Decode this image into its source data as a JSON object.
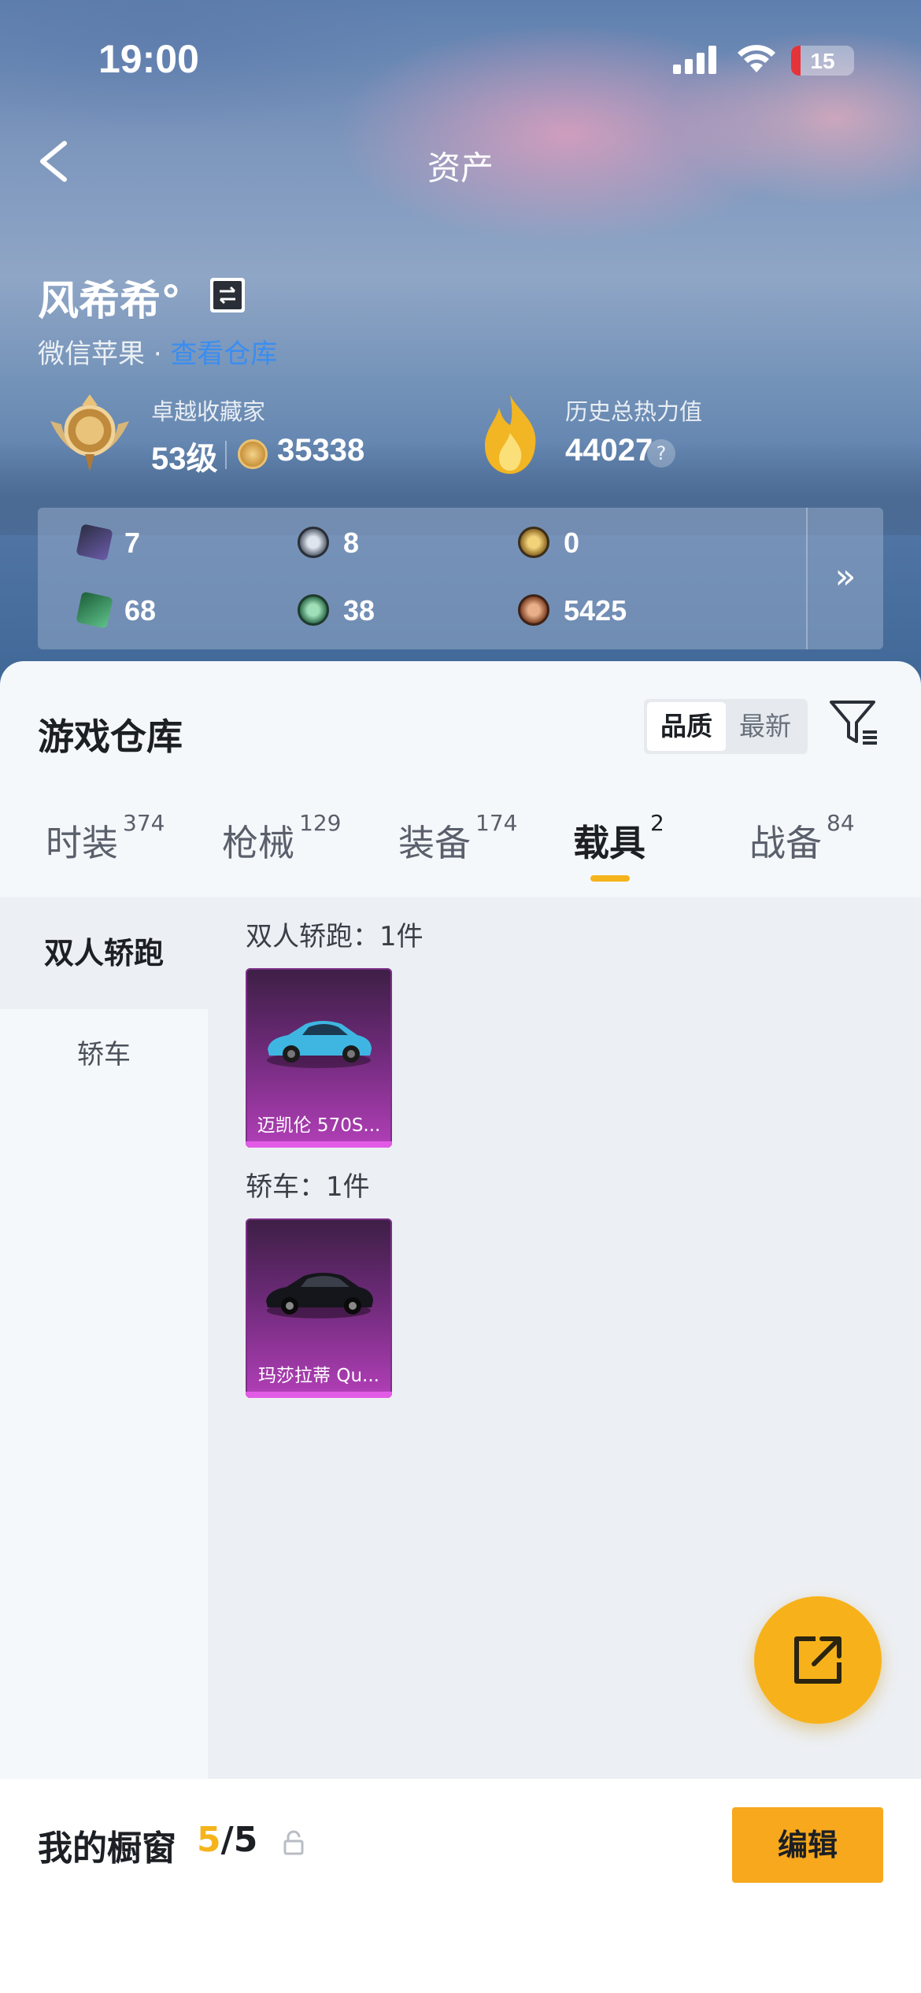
{
  "status": {
    "time": "19:00",
    "battery": "15"
  },
  "nav": {
    "title": "资产"
  },
  "profile": {
    "name": "风希希°",
    "platform": "微信苹果",
    "platform_link": "查看仓库",
    "collector": {
      "label": "卓越收藏家",
      "level": "53级",
      "points": "35338"
    },
    "heat": {
      "label": "历史总热力值",
      "value": "44027"
    }
  },
  "stats": [
    {
      "icon": "purple-card-icon",
      "value": "7"
    },
    {
      "icon": "gray-coin-icon",
      "value": "8"
    },
    {
      "icon": "gold-coin-icon",
      "value": "0"
    },
    {
      "icon": "green-card-icon",
      "value": "68"
    },
    {
      "icon": "green-coin-icon",
      "value": "38"
    },
    {
      "icon": "bronze-coin-icon",
      "value": "5425"
    }
  ],
  "warehouse": {
    "title": "游戏仓库",
    "sort": {
      "quality": "品质",
      "newest": "最新"
    },
    "tabs": [
      {
        "label": "时装",
        "count": "374"
      },
      {
        "label": "枪械",
        "count": "129"
      },
      {
        "label": "装备",
        "count": "174"
      },
      {
        "label": "载具",
        "count": "2"
      },
      {
        "label": "战备",
        "count": "84"
      }
    ],
    "sidebar": [
      "双人轿跑",
      "轿车"
    ],
    "groups": [
      {
        "title": "双人轿跑：1件",
        "item": "迈凯伦 570S..."
      },
      {
        "title": "轿车：1件",
        "item": "玛莎拉蒂 Qu..."
      }
    ]
  },
  "showcase": {
    "label": "我的橱窗",
    "used": "5",
    "total": "/5",
    "edit": "编辑"
  },
  "colors": {
    "accent": "#f7b21b",
    "tab_underline": "#f5b41c",
    "link": "#3a8df0"
  }
}
